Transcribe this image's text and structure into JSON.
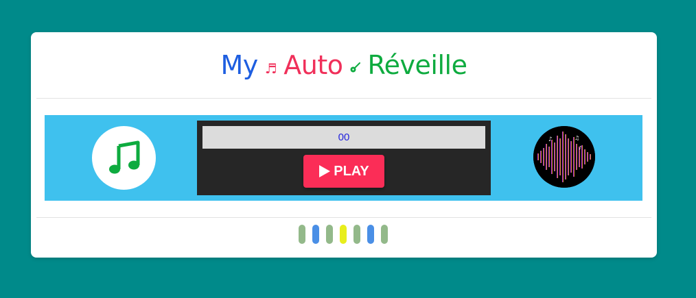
{
  "header": {
    "word1": "My",
    "word2": "Auto",
    "word3": "Réveille",
    "note_glyph": "♬",
    "guitar_glyph": "🎸"
  },
  "player": {
    "timer": "00",
    "play_label": "PLAY"
  },
  "icons": {
    "left": "music-note-icon",
    "play": "play-triangle-icon",
    "right": "spectrum-equalizer-icon"
  },
  "colors": {
    "background": "#008a8a",
    "band": "#3fc1ee",
    "player": "#262626",
    "play_button": "#fb2d57",
    "title_my": "#1e5ee0",
    "title_auto": "#f0305a",
    "title_reveille": "#0eab3f",
    "music_icon": "#0eab3f"
  },
  "loader": {
    "bar_colors": [
      "#93b98a",
      "#4a8fe6",
      "#93b98a",
      "#e8ee1c",
      "#93b98a",
      "#4a8fe6",
      "#93b98a"
    ]
  }
}
